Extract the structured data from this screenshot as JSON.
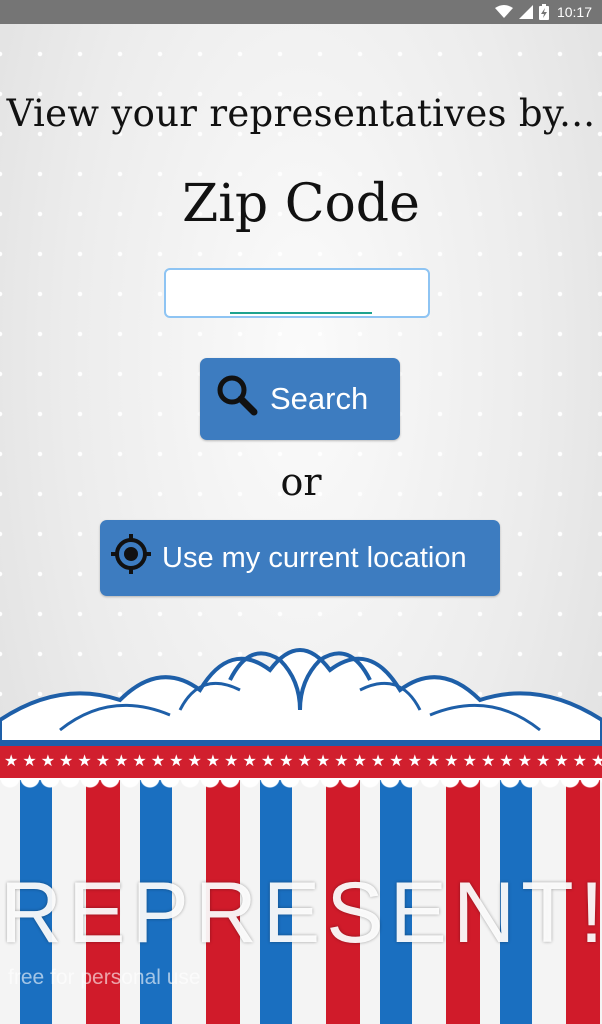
{
  "status_bar": {
    "time": "10:17"
  },
  "headline": "View your representatives by...",
  "zip_section": {
    "title": "Zip Code",
    "input_value": "",
    "input_placeholder": ""
  },
  "search_button": {
    "label": "Search",
    "icon": "search-icon"
  },
  "or_text": "or",
  "location_button": {
    "label": "Use my current location",
    "icon": "crosshair-icon"
  },
  "brand": {
    "text": "REPRESENT!"
  },
  "watermark": "free for personal use",
  "colors": {
    "button": "#3d7cc0",
    "stripe_blue": "#1a6fc0",
    "stripe_red": "#d01b2a",
    "input_border": "#8ec4f3",
    "input_underline": "#1ea38f"
  }
}
